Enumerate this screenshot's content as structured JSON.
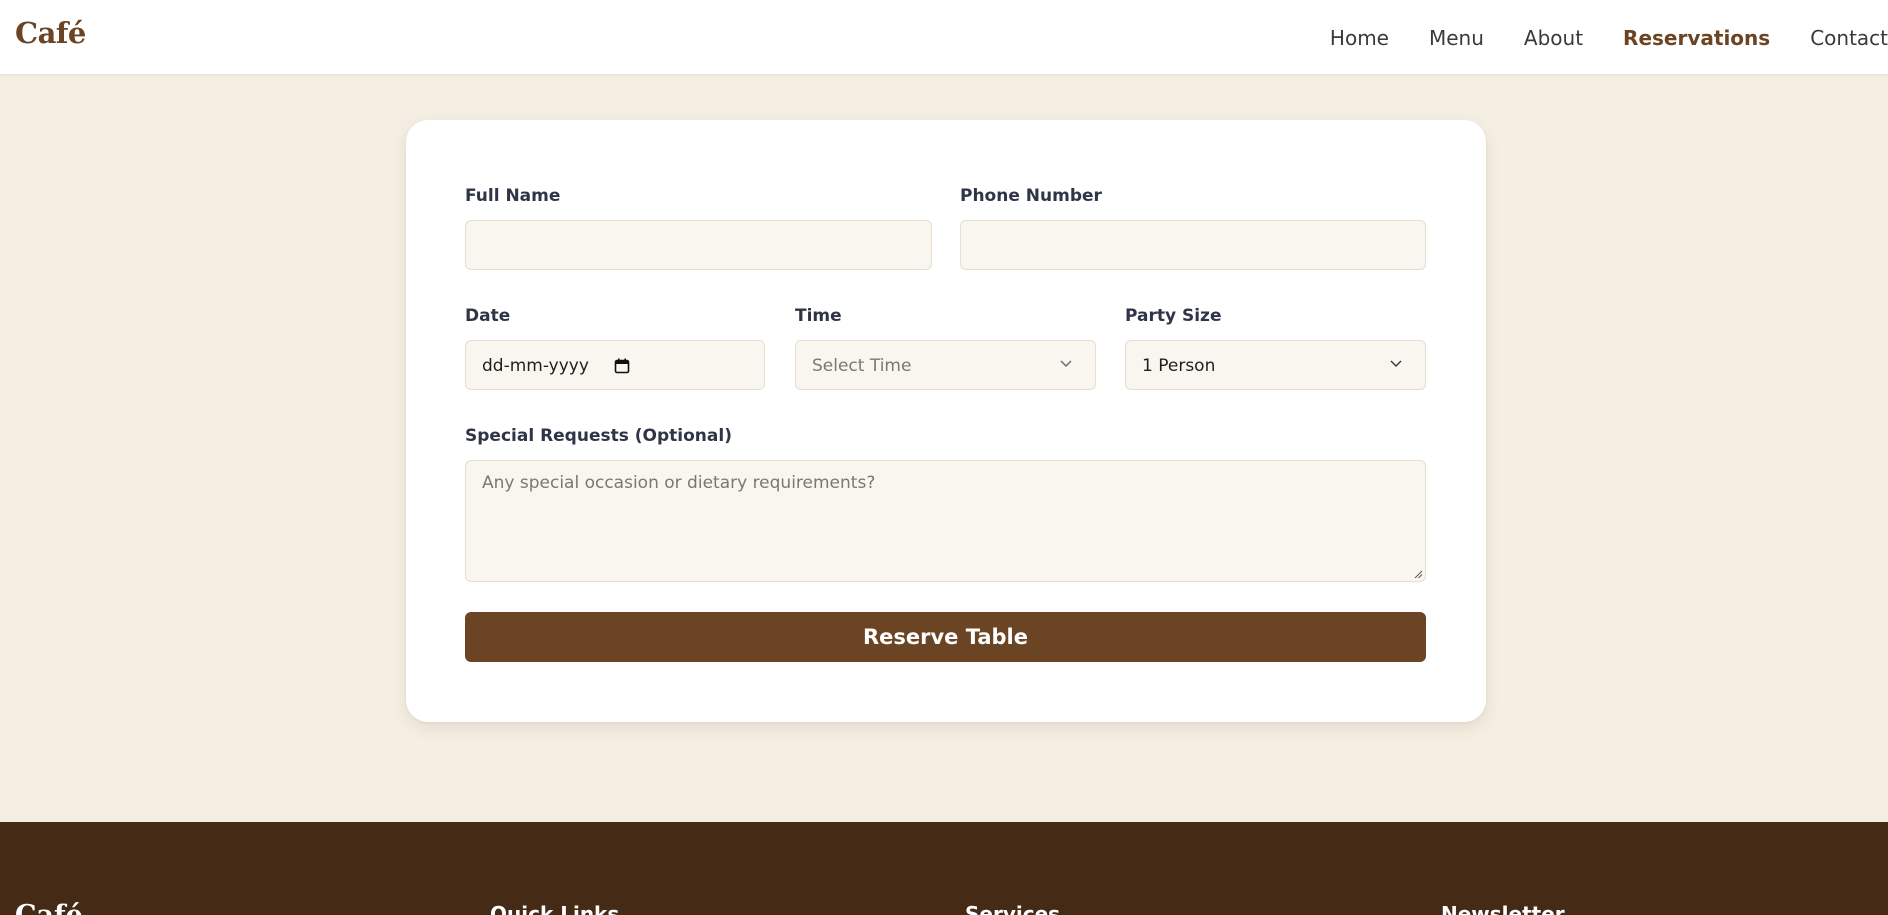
{
  "header": {
    "logo": "Café",
    "nav": [
      {
        "label": "Home"
      },
      {
        "label": "Menu"
      },
      {
        "label": "About"
      },
      {
        "label": "Reservations",
        "active": true
      },
      {
        "label": "Contact"
      }
    ]
  },
  "form": {
    "full_name": {
      "label": "Full Name",
      "value": ""
    },
    "phone": {
      "label": "Phone Number",
      "value": ""
    },
    "date": {
      "label": "Date",
      "value": "dd-mm-yyyy"
    },
    "time": {
      "label": "Time",
      "placeholder": "Select Time"
    },
    "party_size": {
      "label": "Party Size",
      "value": "1 Person"
    },
    "special_requests": {
      "label": "Special Requests (Optional)",
      "placeholder": "Any special occasion or dietary requirements?"
    },
    "submit_label": "Reserve Table"
  },
  "footer": {
    "logo": "Café",
    "headings": [
      "Quick Links",
      "Services",
      "Newsletter"
    ]
  },
  "colors": {
    "brand": "#6b4423",
    "page_bg": "#f5efe3",
    "footer_bg": "#452b15",
    "field_bg": "#f9f6f0"
  },
  "icons": {
    "calendar": "calendar-icon",
    "dropdown": "chevron-down-icon",
    "resize": "resize-grip-icon"
  }
}
